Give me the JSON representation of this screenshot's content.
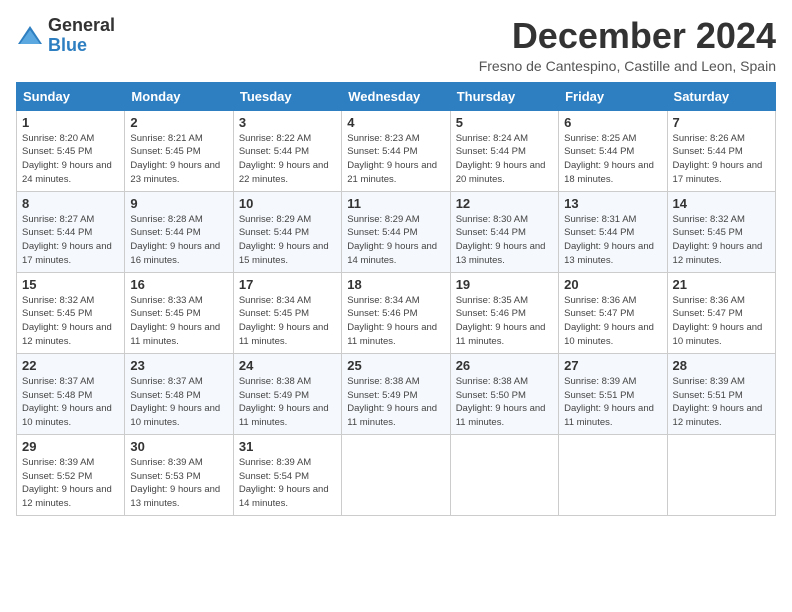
{
  "logo": {
    "general": "General",
    "blue": "Blue"
  },
  "title": "December 2024",
  "subtitle": "Fresno de Cantespino, Castille and Leon, Spain",
  "headers": [
    "Sunday",
    "Monday",
    "Tuesday",
    "Wednesday",
    "Thursday",
    "Friday",
    "Saturday"
  ],
  "weeks": [
    [
      {
        "day": "1",
        "sunrise": "Sunrise: 8:20 AM",
        "sunset": "Sunset: 5:45 PM",
        "daylight": "Daylight: 9 hours and 24 minutes."
      },
      {
        "day": "2",
        "sunrise": "Sunrise: 8:21 AM",
        "sunset": "Sunset: 5:45 PM",
        "daylight": "Daylight: 9 hours and 23 minutes."
      },
      {
        "day": "3",
        "sunrise": "Sunrise: 8:22 AM",
        "sunset": "Sunset: 5:44 PM",
        "daylight": "Daylight: 9 hours and 22 minutes."
      },
      {
        "day": "4",
        "sunrise": "Sunrise: 8:23 AM",
        "sunset": "Sunset: 5:44 PM",
        "daylight": "Daylight: 9 hours and 21 minutes."
      },
      {
        "day": "5",
        "sunrise": "Sunrise: 8:24 AM",
        "sunset": "Sunset: 5:44 PM",
        "daylight": "Daylight: 9 hours and 20 minutes."
      },
      {
        "day": "6",
        "sunrise": "Sunrise: 8:25 AM",
        "sunset": "Sunset: 5:44 PM",
        "daylight": "Daylight: 9 hours and 18 minutes."
      },
      {
        "day": "7",
        "sunrise": "Sunrise: 8:26 AM",
        "sunset": "Sunset: 5:44 PM",
        "daylight": "Daylight: 9 hours and 17 minutes."
      }
    ],
    [
      {
        "day": "8",
        "sunrise": "Sunrise: 8:27 AM",
        "sunset": "Sunset: 5:44 PM",
        "daylight": "Daylight: 9 hours and 17 minutes."
      },
      {
        "day": "9",
        "sunrise": "Sunrise: 8:28 AM",
        "sunset": "Sunset: 5:44 PM",
        "daylight": "Daylight: 9 hours and 16 minutes."
      },
      {
        "day": "10",
        "sunrise": "Sunrise: 8:29 AM",
        "sunset": "Sunset: 5:44 PM",
        "daylight": "Daylight: 9 hours and 15 minutes."
      },
      {
        "day": "11",
        "sunrise": "Sunrise: 8:29 AM",
        "sunset": "Sunset: 5:44 PM",
        "daylight": "Daylight: 9 hours and 14 minutes."
      },
      {
        "day": "12",
        "sunrise": "Sunrise: 8:30 AM",
        "sunset": "Sunset: 5:44 PM",
        "daylight": "Daylight: 9 hours and 13 minutes."
      },
      {
        "day": "13",
        "sunrise": "Sunrise: 8:31 AM",
        "sunset": "Sunset: 5:44 PM",
        "daylight": "Daylight: 9 hours and 13 minutes."
      },
      {
        "day": "14",
        "sunrise": "Sunrise: 8:32 AM",
        "sunset": "Sunset: 5:45 PM",
        "daylight": "Daylight: 9 hours and 12 minutes."
      }
    ],
    [
      {
        "day": "15",
        "sunrise": "Sunrise: 8:32 AM",
        "sunset": "Sunset: 5:45 PM",
        "daylight": "Daylight: 9 hours and 12 minutes."
      },
      {
        "day": "16",
        "sunrise": "Sunrise: 8:33 AM",
        "sunset": "Sunset: 5:45 PM",
        "daylight": "Daylight: 9 hours and 11 minutes."
      },
      {
        "day": "17",
        "sunrise": "Sunrise: 8:34 AM",
        "sunset": "Sunset: 5:45 PM",
        "daylight": "Daylight: 9 hours and 11 minutes."
      },
      {
        "day": "18",
        "sunrise": "Sunrise: 8:34 AM",
        "sunset": "Sunset: 5:46 PM",
        "daylight": "Daylight: 9 hours and 11 minutes."
      },
      {
        "day": "19",
        "sunrise": "Sunrise: 8:35 AM",
        "sunset": "Sunset: 5:46 PM",
        "daylight": "Daylight: 9 hours and 11 minutes."
      },
      {
        "day": "20",
        "sunrise": "Sunrise: 8:36 AM",
        "sunset": "Sunset: 5:47 PM",
        "daylight": "Daylight: 9 hours and 10 minutes."
      },
      {
        "day": "21",
        "sunrise": "Sunrise: 8:36 AM",
        "sunset": "Sunset: 5:47 PM",
        "daylight": "Daylight: 9 hours and 10 minutes."
      }
    ],
    [
      {
        "day": "22",
        "sunrise": "Sunrise: 8:37 AM",
        "sunset": "Sunset: 5:48 PM",
        "daylight": "Daylight: 9 hours and 10 minutes."
      },
      {
        "day": "23",
        "sunrise": "Sunrise: 8:37 AM",
        "sunset": "Sunset: 5:48 PM",
        "daylight": "Daylight: 9 hours and 10 minutes."
      },
      {
        "day": "24",
        "sunrise": "Sunrise: 8:38 AM",
        "sunset": "Sunset: 5:49 PM",
        "daylight": "Daylight: 9 hours and 11 minutes."
      },
      {
        "day": "25",
        "sunrise": "Sunrise: 8:38 AM",
        "sunset": "Sunset: 5:49 PM",
        "daylight": "Daylight: 9 hours and 11 minutes."
      },
      {
        "day": "26",
        "sunrise": "Sunrise: 8:38 AM",
        "sunset": "Sunset: 5:50 PM",
        "daylight": "Daylight: 9 hours and 11 minutes."
      },
      {
        "day": "27",
        "sunrise": "Sunrise: 8:39 AM",
        "sunset": "Sunset: 5:51 PM",
        "daylight": "Daylight: 9 hours and 11 minutes."
      },
      {
        "day": "28",
        "sunrise": "Sunrise: 8:39 AM",
        "sunset": "Sunset: 5:51 PM",
        "daylight": "Daylight: 9 hours and 12 minutes."
      }
    ],
    [
      {
        "day": "29",
        "sunrise": "Sunrise: 8:39 AM",
        "sunset": "Sunset: 5:52 PM",
        "daylight": "Daylight: 9 hours and 12 minutes."
      },
      {
        "day": "30",
        "sunrise": "Sunrise: 8:39 AM",
        "sunset": "Sunset: 5:53 PM",
        "daylight": "Daylight: 9 hours and 13 minutes."
      },
      {
        "day": "31",
        "sunrise": "Sunrise: 8:39 AM",
        "sunset": "Sunset: 5:54 PM",
        "daylight": "Daylight: 9 hours and 14 minutes."
      },
      null,
      null,
      null,
      null
    ]
  ]
}
